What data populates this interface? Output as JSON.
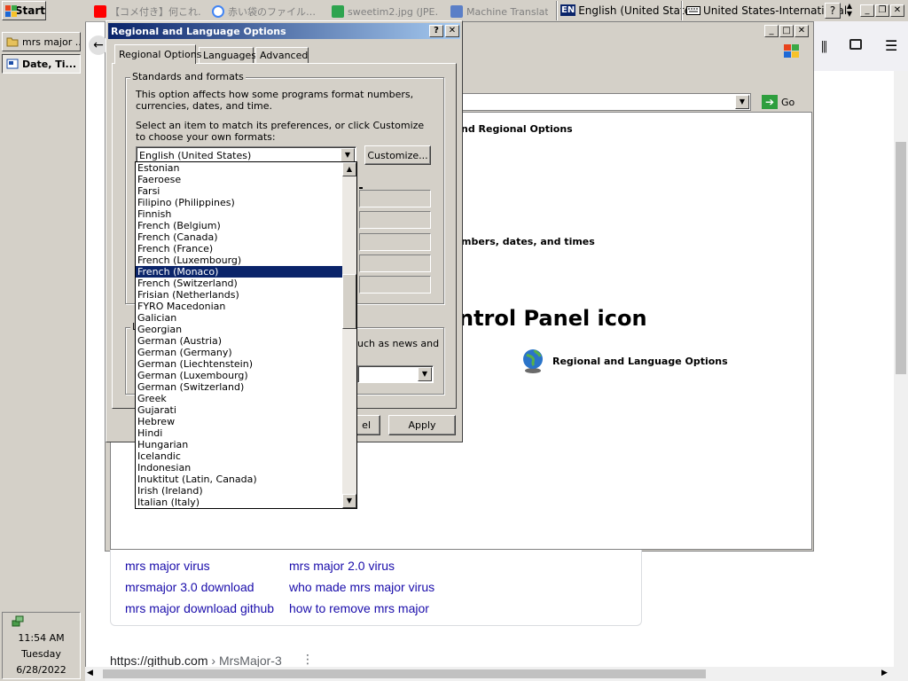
{
  "taskbar": {
    "start_label": "Start",
    "tasks": [
      {
        "label": "mrs major ...",
        "icon": "folder-icon"
      },
      {
        "label": "Date, Ti...",
        "icon": "control-panel-icon"
      }
    ],
    "clock": {
      "time": "11:54 AM",
      "day": "Tuesday",
      "date": "6/28/2022"
    }
  },
  "browser_tabs": [
    {
      "label": "【コメ付き】何これ…",
      "icon": "youtube-icon",
      "color": "#ff0000"
    },
    {
      "label": "赤い袋のファイル…",
      "icon": "google-icon",
      "color": "#4285f4"
    },
    {
      "label": "sweetim2.jpg (JPE…",
      "icon": "leaf-icon",
      "color": "#2ea44f"
    },
    {
      "label": "Machine Translatio…",
      "icon": "translate-icon",
      "color": "#5b7fc7"
    }
  ],
  "tray": {
    "language_code": "EN",
    "language": "English (United States)",
    "keyboard": "United States-International"
  },
  "browser": {
    "go_label": "Go",
    "heading_fragment_1": "nd Regional Options",
    "heading_fragment_2": "mbers, dates, and times",
    "big_heading_fragment": "ntrol Panel icon",
    "cp_item_label": "Regional and Language Options",
    "related_searches": [
      [
        "mrs major virus",
        "mrs major 2.0 virus"
      ],
      [
        "mrsmajor 3.0 download",
        "who made mrs major virus"
      ],
      [
        "mrs major download github",
        "how to remove mrs major"
      ]
    ],
    "result_url": "https://github.com",
    "result_path": "› MrsMajor-3"
  },
  "dialog": {
    "title": "Regional and Language Options",
    "help_glyph": "?",
    "close_glyph": "✕",
    "tabs": [
      "Regional Options",
      "Languages",
      "Advanced"
    ],
    "group_standards": "Standards and formats",
    "desc1": "This option affects how some programs format numbers, currencies, dates, and time.",
    "desc2": "Select an item to match its preferences, or click Customize to choose your own formats:",
    "selected_locale": "English (United States)",
    "customize_label": "Customize...",
    "location_group_label": "L",
    "location_desc_fragment": "uch as news and",
    "cancel_fragment": "el",
    "apply_label": "Apply"
  },
  "dropdown": {
    "items": [
      "Estonian",
      "Faeroese",
      "Farsi",
      "Filipino (Philippines)",
      "Finnish",
      "French (Belgium)",
      "French (Canada)",
      "French (France)",
      "French (Luxembourg)",
      "French (Monaco)",
      "French (Switzerland)",
      "Frisian (Netherlands)",
      "FYRO Macedonian",
      "Galician",
      "Georgian",
      "German (Austria)",
      "German (Germany)",
      "German (Liechtenstein)",
      "German (Luxembourg)",
      "German (Switzerland)",
      "Greek",
      "Gujarati",
      "Hebrew",
      "Hindi",
      "Hungarian",
      "Icelandic",
      "Indonesian",
      "Inuktitut (Latin, Canada)",
      "Irish (Ireland)",
      "Italian (Italy)"
    ],
    "selected_index": 9,
    "scroll_position": 0.37
  },
  "colors": {
    "title_active": "#0a246a",
    "selection": "#0a246a",
    "link": "#1a0dab",
    "chrome": "#d4d0c8"
  }
}
